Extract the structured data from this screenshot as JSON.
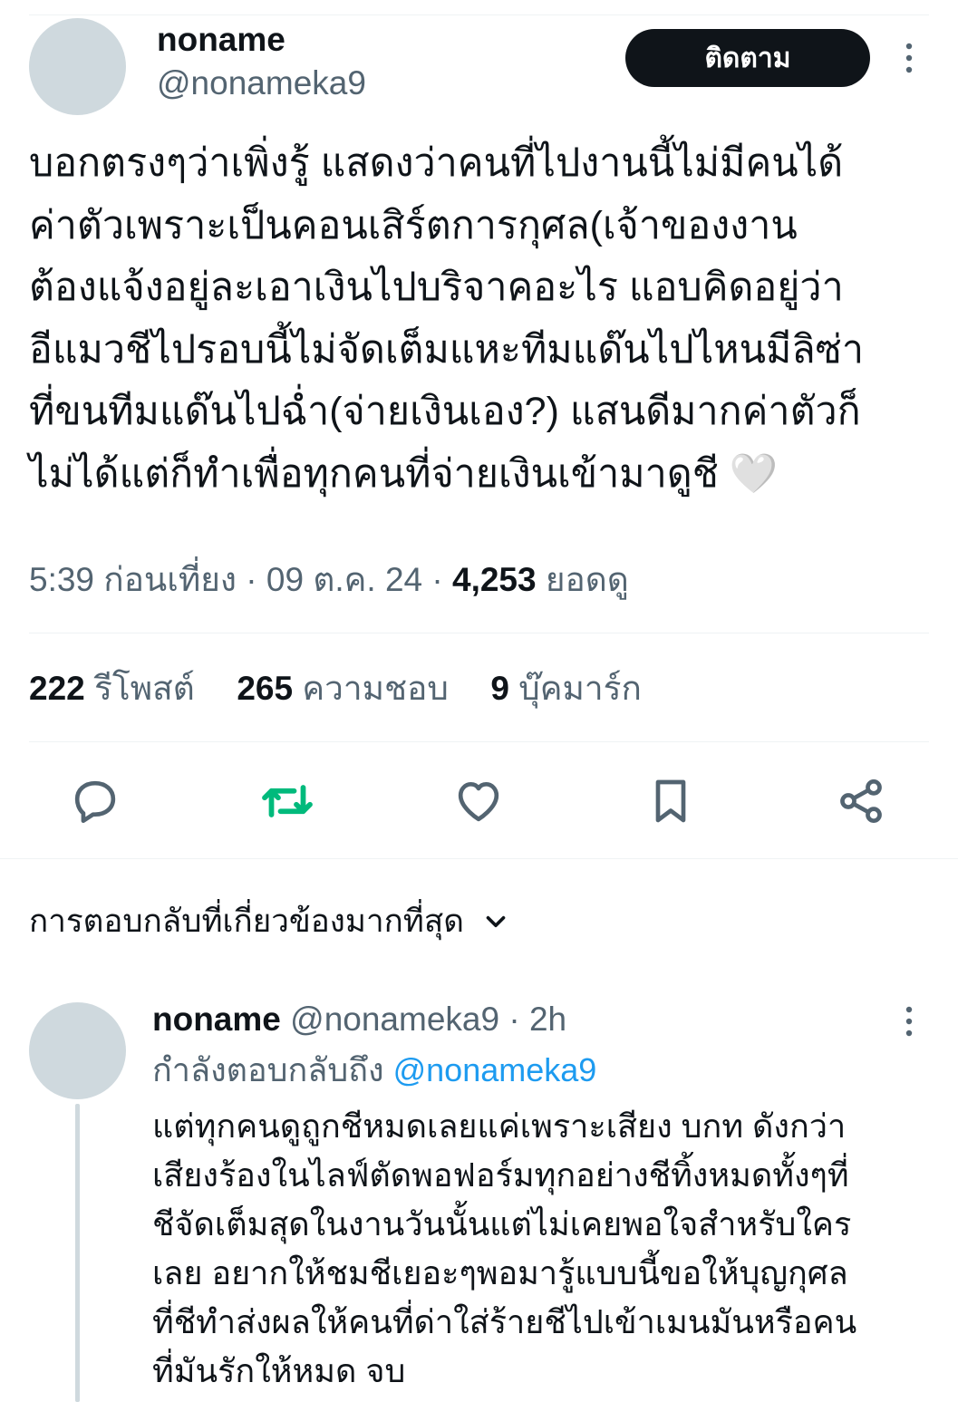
{
  "tweet": {
    "display_name": "noname",
    "handle": "@nonameka9",
    "follow_label": "ติดตาม",
    "text_lines": [
      "บอกตรงๆว่าเพิ่งรู้ แสดงว่าคนที่ไปงานนี้ไม่มีคนได้",
      "ค่าตัวเพราะเป็นคอนเสิร์ตการกุศล(เจ้าของงาน",
      "ต้องแจ้งอยู่ละเอาเงินไปบริจาคอะไร แอบคิดอยู่ว่า",
      "อีแมวชีไปรอบนี้ไม่จัดเต็มแหะทีมแด๊นไปไหนมีลิซ่า",
      "ที่ขนทีมแด๊นไปฉ่ำ(จ่ายเงินเอง?) แสนดีมากค่าตัวก็",
      "ไม่ได้แต่ก็ทำเพื่อทุกคนที่จ่ายเงินเข้ามาดูชี 🤍"
    ],
    "time": "5:39 ก่อนเที่ยง",
    "date": "09 ต.ค. 24",
    "views_count": "4,253",
    "views_label": "ยอดดู",
    "reposts_count": "222",
    "reposts_label": "รีโพสต์",
    "likes_count": "265",
    "likes_label": "ความชอบ",
    "bookmarks_count": "9",
    "bookmarks_label": "บุ๊คมาร์ก"
  },
  "actions": {
    "reply_icon": "reply-bubble-icon",
    "repost_icon": "repost-icon",
    "like_icon": "heart-icon",
    "bookmark_icon": "bookmark-icon",
    "share_icon": "share-icon"
  },
  "replies_sort_label": "การตอบกลับที่เกี่ยวข้องมากที่สุด",
  "reply": {
    "display_name": "noname",
    "handle": "@nonameka9",
    "time": "2h",
    "replying_to_label": "กำลังตอบกลับถึง",
    "replying_to_handle": "@nonameka9",
    "text_lines": [
      "แต่ทุกคนดูถูกชีหมดเลยแค่เพราะเสียง บกท ดังกว่า",
      "เสียงร้องในไลฟ์ตัดพอฟอร์มทุกอย่างชีทิ้งหมดทั้งๆที่",
      "ชีจัดเต็มสุดในงานวันนั้นแต่ไม่เคยพอใจสำหรับใคร",
      "เลย อยากให้ชมชีเยอะๆพอมารู้แบบนี้ขอให้บุญกุศล",
      "ที่ชีทำส่งผลให้คนที่ด่าใส่ร้ายชีไปเข้าเมนมันหรือคน",
      "ที่มันรักให้หมด จบ"
    ]
  },
  "colors": {
    "text": "#0f1419",
    "muted": "#536471",
    "link": "#1d9bf0",
    "repost_green": "#00ba7c",
    "avatar_placeholder": "#cfd9de",
    "divider": "#eff3f4"
  }
}
